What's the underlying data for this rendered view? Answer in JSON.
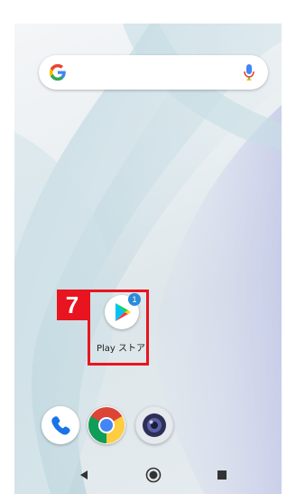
{
  "home": {
    "search_bar": {
      "logo": "google-g-icon",
      "mic": "mic-icon"
    },
    "app": {
      "label": "Play ストア",
      "badge": "1",
      "icon": "play-store-icon"
    },
    "annotation": {
      "step_number": "7",
      "color": "#e8141f"
    },
    "dock": [
      "phone-icon",
      "chrome-icon",
      "camera-icon"
    ],
    "navbar": [
      "back-icon",
      "home-icon",
      "recents-icon"
    ]
  }
}
